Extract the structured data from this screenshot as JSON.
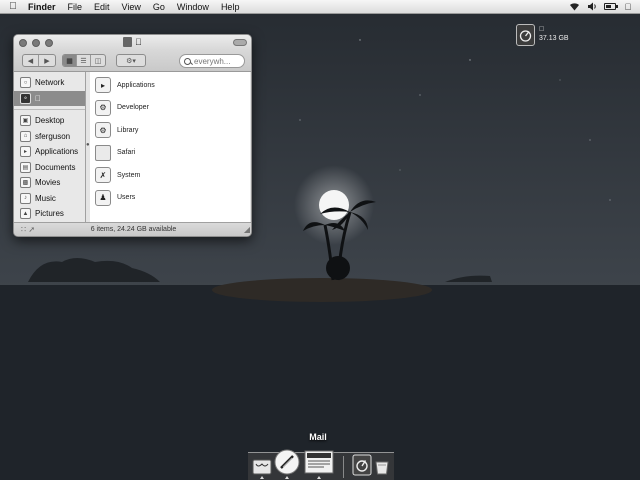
{
  "menubar": {
    "apple": "",
    "items": [
      "Finder",
      "File",
      "Edit",
      "View",
      "Go",
      "Window",
      "Help"
    ],
    "status_icons": [
      "wifi-icon",
      "volume-icon",
      "battery-icon",
      "apple-icon"
    ],
    "battery_level": 0.6
  },
  "desktop": {
    "volume": {
      "name": "",
      "size": "37.13 GB"
    }
  },
  "finder": {
    "title": "",
    "search": {
      "placeholder": "everywh..."
    },
    "sidebar": {
      "devices": [
        {
          "label": "Network",
          "icon": "network-icon"
        },
        {
          "label": "",
          "icon": "hard-disk-icon",
          "selected": true
        }
      ],
      "places": [
        {
          "label": "Desktop",
          "icon": "desktop-icon"
        },
        {
          "label": "sferguson",
          "icon": "home-icon"
        },
        {
          "label": "Applications",
          "icon": "applications-icon"
        },
        {
          "label": "Documents",
          "icon": "documents-icon"
        },
        {
          "label": "Movies",
          "icon": "movies-icon"
        },
        {
          "label": "Music",
          "icon": "music-icon"
        },
        {
          "label": "Pictures",
          "icon": "pictures-icon"
        }
      ]
    },
    "files": [
      {
        "name": "Applications",
        "icon": "applications-folder-icon"
      },
      {
        "name": "Developer",
        "icon": "developer-folder-icon"
      },
      {
        "name": "Library",
        "icon": "library-folder-icon"
      },
      {
        "name": "Safari",
        "icon": "folder-icon"
      },
      {
        "name": "System",
        "icon": "system-folder-icon"
      },
      {
        "name": "Users",
        "icon": "users-folder-icon"
      }
    ],
    "status": "6 items, 24.24 GB available"
  },
  "dock": {
    "hover_label": "Mail",
    "items": [
      "finder-icon",
      "safari-icon",
      "mail-icon",
      "hard-disk-icon",
      "trash-icon"
    ]
  },
  "colors": {
    "sky_top": "#2a2f36",
    "sky_bottom": "#3b4148",
    "sea": "#1e2329",
    "moon": "#f5f5f5"
  }
}
